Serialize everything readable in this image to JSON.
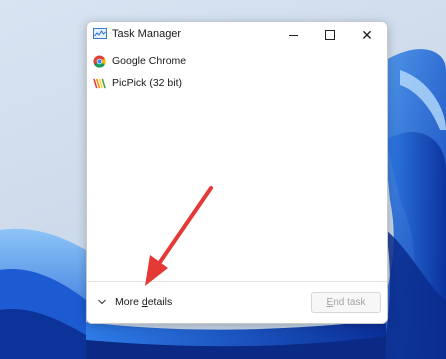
{
  "window": {
    "title": "Task Manager",
    "icon": "task-manager-icon"
  },
  "tasks": [
    {
      "label": "Google Chrome",
      "icon": "chrome-icon"
    },
    {
      "label": "PicPick (32 bit)",
      "icon": "picpick-icon"
    }
  ],
  "footer": {
    "more_details_label": "More details",
    "end_task_label": "End task"
  },
  "colors": {
    "arrow": "#e53935",
    "wallpaper_blue": "#1f63d6",
    "end_task_disabled_text": "#a3a3a3"
  }
}
